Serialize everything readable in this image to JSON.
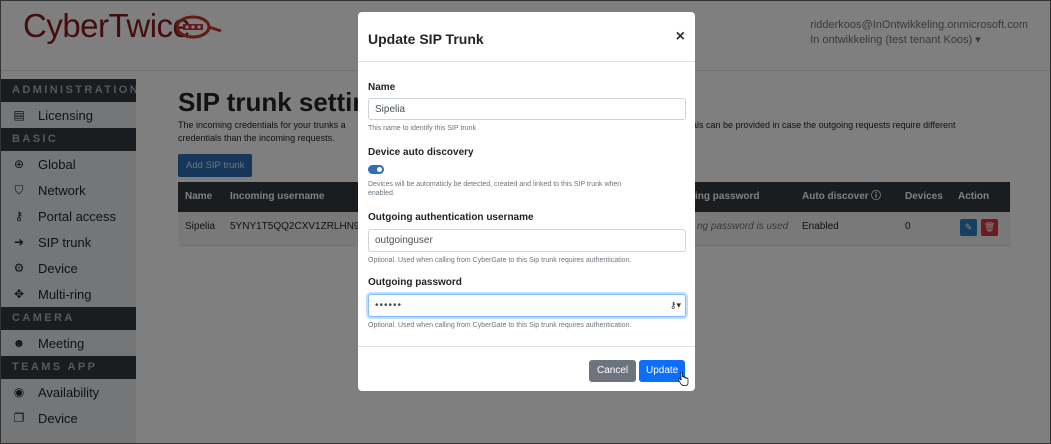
{
  "colors": {
    "brand": "#8b1a1a",
    "sidebar_section_bg": "#343a40",
    "primary": "#2f6fb5",
    "edit_action": "#2f7fc1",
    "delete_action": "#dc3545",
    "cancel": "#6c757d"
  },
  "header": {
    "logo_text": "CyberTwice",
    "user_email": "ridderkoos@InOntwikkeling.onmicrosoft.com",
    "tenant": "In ontwikkeling (test tenant Koos) ▾"
  },
  "sidebar": {
    "sections": [
      {
        "title": "Administration",
        "items": [
          {
            "label": "Licensing",
            "icon": "file-icon"
          }
        ]
      },
      {
        "title": "Basic",
        "items": [
          {
            "label": "Global",
            "icon": "globe-icon"
          },
          {
            "label": "Network",
            "icon": "shield-icon"
          },
          {
            "label": "Portal access",
            "icon": "key-icon"
          },
          {
            "label": "SIP trunk",
            "icon": "sign-in-icon"
          },
          {
            "label": "Device",
            "icon": "cogs-icon"
          },
          {
            "label": "Multi-ring",
            "icon": "arrows-icon"
          }
        ]
      },
      {
        "title": "Camera",
        "items": [
          {
            "label": "Meeting",
            "icon": "users-icon"
          }
        ]
      },
      {
        "title": "Teams App",
        "items": [
          {
            "label": "Availability",
            "icon": "user-circle-icon"
          },
          {
            "label": "Device",
            "icon": "copy-icon"
          }
        ]
      }
    ]
  },
  "main": {
    "title": "SIP trunk settings",
    "description_left_1": "The incoming credentials for your trunks a",
    "description_left_2": "credentials than the incoming requests.",
    "description_right": "als can be provided in case the outgoing requests require different",
    "add_button": "Add SIP trunk",
    "table": {
      "headers": [
        "Name",
        "Incoming username",
        "ing password",
        "Auto discover",
        "Devices",
        "Action"
      ],
      "rows": [
        {
          "name": "Sipelia",
          "incoming_username": "5YNY1T5QQ2CXV1ZRLHN9",
          "password": "ng password is used",
          "auto_discover": "Enabled",
          "devices": "0"
        }
      ]
    }
  },
  "modal": {
    "title": "Update SIP Trunk",
    "close": "×",
    "name_label": "Name",
    "name_value": "Sipelia",
    "name_help": "This name to identify this SIP trunk",
    "discovery_label": "Device auto discovery",
    "discovery_enabled": true,
    "discovery_help_1": "Devices will be automaticly be detected, created and linked to this SIP trunk when",
    "discovery_help_2": "enabled.",
    "out_user_label": "Outgoing authentication username",
    "out_user_value": "outgoinguser",
    "out_user_help": "Optional. Used when calling from CyberGate to this Sip trunk requires authentication.",
    "out_pw_label": "Outgoing password",
    "out_pw_value": "••••••",
    "out_pw_help": "Optional. Used when calling from CyberGate to this Sip trunk requires authentication.",
    "cancel_label": "Cancel",
    "update_label": "Update"
  }
}
